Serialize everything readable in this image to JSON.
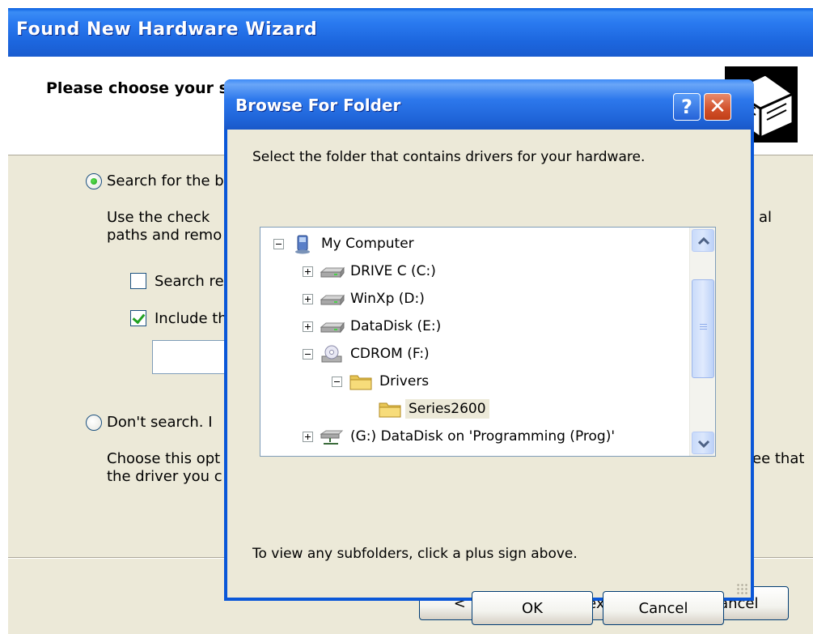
{
  "wizard": {
    "title": "Found New Hardware Wizard",
    "heading": "Please choose your search and installation options.",
    "option_search_label": "Search for the b",
    "option_search_desc_line1": "Use the check",
    "option_search_desc_line1_right": "al",
    "option_search_desc_line2": "paths and remo",
    "check_removable_label": "Search re",
    "check_include_label": "Include th",
    "option_dont_label": "Don't search. I",
    "option_dont_desc_line1": "Choose this opt",
    "option_dont_desc_line1_right": "ee that",
    "option_dont_desc_line2": "the driver you c",
    "back_label": "< Back",
    "next_label": "Next >",
    "cancel_label": "Cancel"
  },
  "browse": {
    "title": "Browse For Folder",
    "help_label": "?",
    "close_label": "✕",
    "prompt": "Select the folder that contains drivers for your hardware.",
    "hint": "To view any subfolders, click a plus sign above.",
    "ok_label": "OK",
    "cancel_label": "Cancel",
    "tree": [
      {
        "label": "My Computer",
        "icon": "my-computer-icon",
        "expander": "minus"
      },
      {
        "label": "DRIVE C (C:)",
        "icon": "hard-drive-icon",
        "expander": "plus"
      },
      {
        "label": "WinXp (D:)",
        "icon": "hard-drive-icon",
        "expander": "plus"
      },
      {
        "label": "DataDisk (E:)",
        "icon": "hard-drive-icon",
        "expander": "plus"
      },
      {
        "label": "CDROM (F:)",
        "icon": "cdrom-icon",
        "expander": "minus"
      },
      {
        "label": "Drivers",
        "icon": "folder-icon",
        "expander": "minus"
      },
      {
        "label": "Series2600",
        "icon": "folder-icon",
        "expander": "none",
        "selected": true
      },
      {
        "label": "(G:) DataDisk on 'Programming (Prog)'",
        "icon": "network-drive-icon",
        "expander": "plus"
      }
    ]
  },
  "colors": {
    "titlebar": "#1c66de",
    "window_face": "#ece9d8",
    "close_button": "#d1502a"
  }
}
